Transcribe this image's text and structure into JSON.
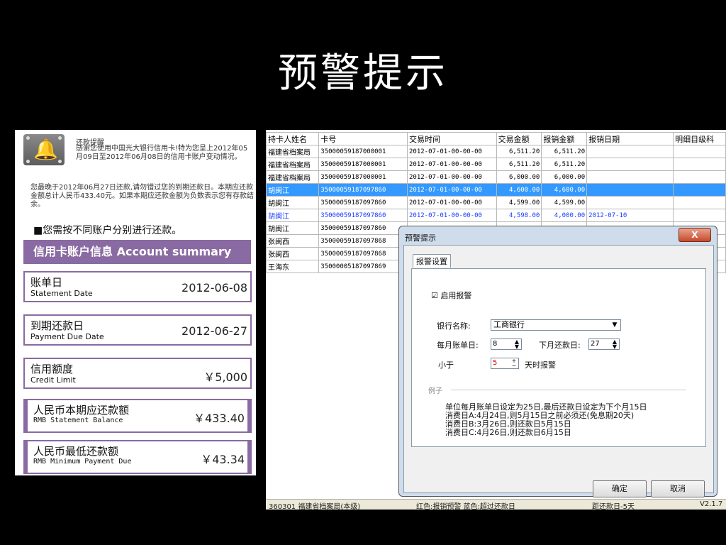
{
  "slide": {
    "title": "预警提示"
  },
  "statement": {
    "remind_title": "还款提醒",
    "remind_body": "感谢您使用中国光大银行信用卡!特为您呈上2012年05月09日至2012年06月08日的信用卡账户变动情况。",
    "notice": "您最晚于2012年06月27日还款,请勿错过您的到期还款日。本期应还款金额总计人民币433.40元。如果本期应还款金额为负数表示您有存款结余。",
    "subnote": "■您需按不同账户分别进行还款。",
    "header": "信用卡账户信息 Account summary",
    "rows": [
      {
        "zh": "账单日",
        "en": "Statement Date",
        "value": "2012-06-08"
      },
      {
        "zh": "到期还款日",
        "en": "Payment Due Date",
        "value": "2012-06-27"
      },
      {
        "zh": "信用额度",
        "en": "Credit Limit",
        "value": "￥5,000"
      },
      {
        "zh": "人民币本期应还款额",
        "en": "RMB Statement Balance",
        "value": "￥433.40"
      },
      {
        "zh": "人民币最低还款额",
        "en": "RMB Minimum Payment Due",
        "value": "￥43.34"
      }
    ]
  },
  "table": {
    "columns": [
      "持卡人姓名",
      "卡号",
      "交易时间",
      "交易金额",
      "报销金额",
      "报销日期",
      "明细目级科"
    ],
    "rows": [
      [
        "福建省档案局",
        "35000059187000001",
        "2012-07-01-00-00-00",
        "6,511.20",
        "6,511.20",
        ""
      ],
      [
        "福建省档案局",
        "35000059187000001",
        "2012-07-01-00-00-00",
        "6,511.20",
        "6,511.20",
        ""
      ],
      [
        "福建省档案局",
        "35000059187000001",
        "2012-07-01-00-00-00",
        "6,000.00",
        "6,000.00",
        ""
      ],
      [
        "胡闽江",
        "35000059187097860",
        "2012-07-01-00-00-00",
        "4,600.00",
        "4,600.00",
        ""
      ],
      [
        "胡闽江",
        "35000059187097860",
        "2012-07-01-00-00-00",
        "4,599.00",
        "4,599.00",
        ""
      ],
      [
        "胡闽江",
        "35000059187097860",
        "2012-07-01-00-00-00",
        "4,598.00",
        "4,000.00",
        "2012-07-10"
      ],
      [
        "胡闽江",
        "35000059187097860",
        "",
        "",
        "",
        ""
      ],
      [
        "张闽西",
        "35000059187097868",
        "",
        "",
        "",
        ""
      ],
      [
        "张闽西",
        "35000059187097868",
        "",
        "",
        "",
        ""
      ],
      [
        "王海东",
        "35000005187097869",
        "",
        "",
        "",
        ""
      ]
    ],
    "selected_row": 3,
    "blue_row": 5
  },
  "status": {
    "org": "360301 福建省档案局(本级)",
    "legend": "红色:报销预警 蓝色:超过还款日",
    "due": "距还款日-5天",
    "version": "V2.1.7"
  },
  "dialog": {
    "title": "预警提示",
    "close_label": "X",
    "tab": "报警设置",
    "enable_label": "启用报警",
    "enable_checked": "☑",
    "bank_label": "银行名称:",
    "bank_value": "工商银行",
    "bill_day_label": "每月账单日:",
    "bill_day_value": "8",
    "due_day_label": "下月还款日:",
    "due_day_value": "27",
    "less_than_label": "小于",
    "less_than_value": "5",
    "days_label": "天时报警",
    "example_legend": "例子",
    "example_lines": [
      "单位每月账单日设定为25日,最后还款日设定为下个月15日",
      "消费日A:4月24日,则5月15日之前必须还(免息期20天)",
      "消费日B:3月26日,则还款日5月15日",
      "消费日C:4月26日,则还款日6月15日"
    ],
    "ok_label": "确定",
    "cancel_label": "取消"
  }
}
